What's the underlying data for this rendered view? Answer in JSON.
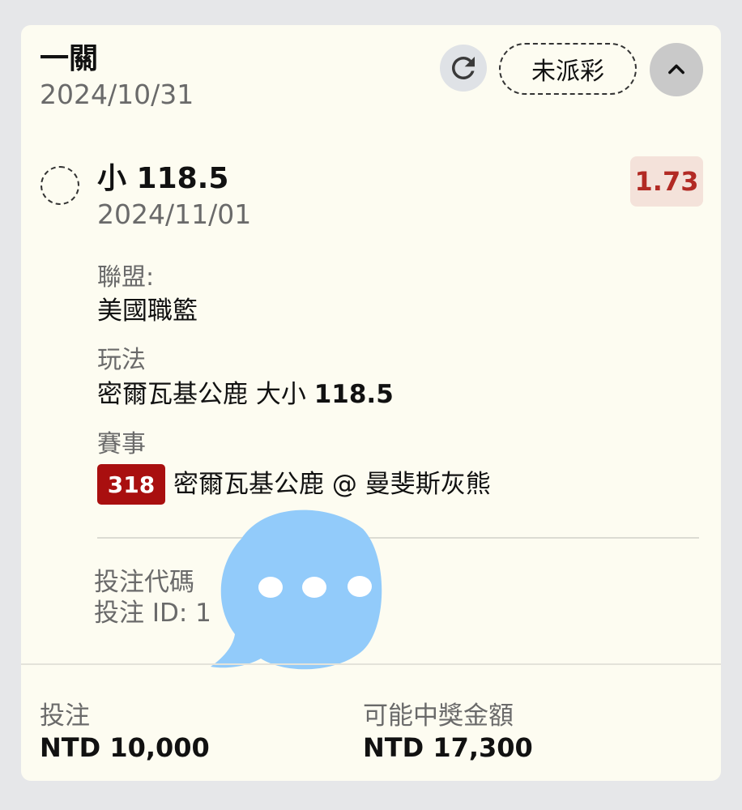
{
  "header": {
    "title": "一關",
    "date": "2024/10/31",
    "status": "未派彩"
  },
  "selection": {
    "name": "小 118.5",
    "date": "2024/11/01",
    "odds": "1.73"
  },
  "details": {
    "league_label": "聯盟:",
    "league_value": "美國職籃",
    "market_label": "玩法",
    "market_value_prefix": "密爾瓦基公鹿 大小 ",
    "market_value_number": "118.5",
    "event_label": "賽事",
    "event_code": "318",
    "event_value": "密爾瓦基公鹿 @ 曼斐斯灰熊"
  },
  "ids": {
    "code_label": "投注代碼",
    "id_label": "投注 ID: 1"
  },
  "footer": {
    "stake_label": "投注",
    "stake_value": "NTD 10,000",
    "payout_label": "可能中獎金額",
    "payout_value": "NTD 17,300"
  },
  "colors": {
    "card_bg": "#fdfcf1",
    "odds_text": "#b22a24",
    "code_badge": "#a90f0f",
    "chat_bubble": "#92cbfa"
  },
  "icons": {
    "refresh": "refresh-icon",
    "collapse": "chevron-up-icon",
    "chat": "chat-bubble-icon"
  }
}
